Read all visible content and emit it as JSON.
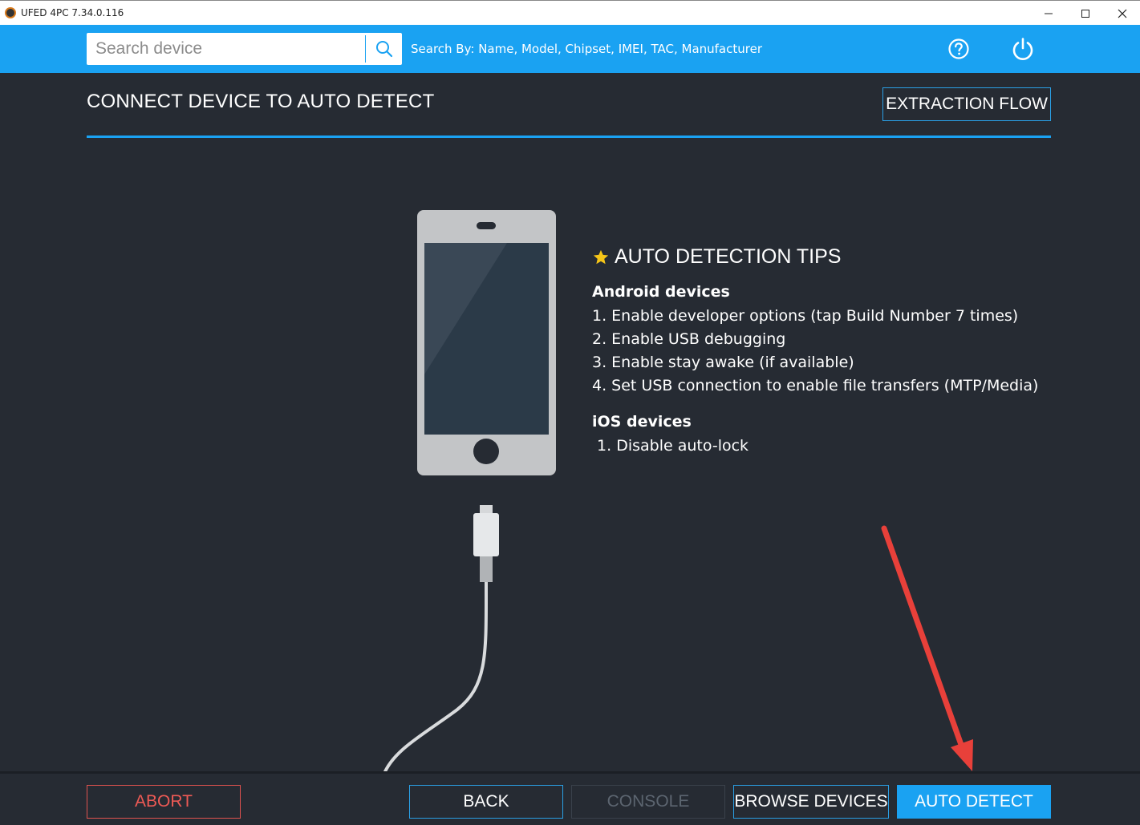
{
  "window": {
    "title": "UFED 4PC 7.34.0.116",
    "minimize_glyph": "—",
    "maximize_glyph": "☐",
    "close_glyph": "✕"
  },
  "header": {
    "search_placeholder": "Search device",
    "search_value": "",
    "search_hint": "Search By: Name, Model, Chipset, IMEI, TAC, Manufacturer",
    "icons": [
      "search-icon",
      "help-icon",
      "power-icon"
    ]
  },
  "page": {
    "title": "CONNECT DEVICE TO AUTO DETECT",
    "extraction_flow_label": "EXTRACTION FLOW"
  },
  "tips": {
    "title": "AUTO DETECTION TIPS",
    "android_heading": "Android devices",
    "android_items": [
      "1. Enable developer options (tap Build Number 7 times)",
      "2. Enable USB debugging",
      "3. Enable stay awake (if available)",
      "4. Set USB connection to enable file transfers (MTP/Media)"
    ],
    "ios_heading": "iOS devices",
    "ios_items": [
      " 1. Disable auto-lock"
    ]
  },
  "footer": {
    "abort": "ABORT",
    "back": "BACK",
    "console": "CONSOLE",
    "browse": "BROWSE DEVICES",
    "auto_detect": "AUTO DETECT"
  },
  "colors": {
    "accent": "#1aa2f2",
    "background": "#262b33",
    "abort": "#ee5a55",
    "annotation_arrow": "#e8403a",
    "star": "#f5c518"
  }
}
